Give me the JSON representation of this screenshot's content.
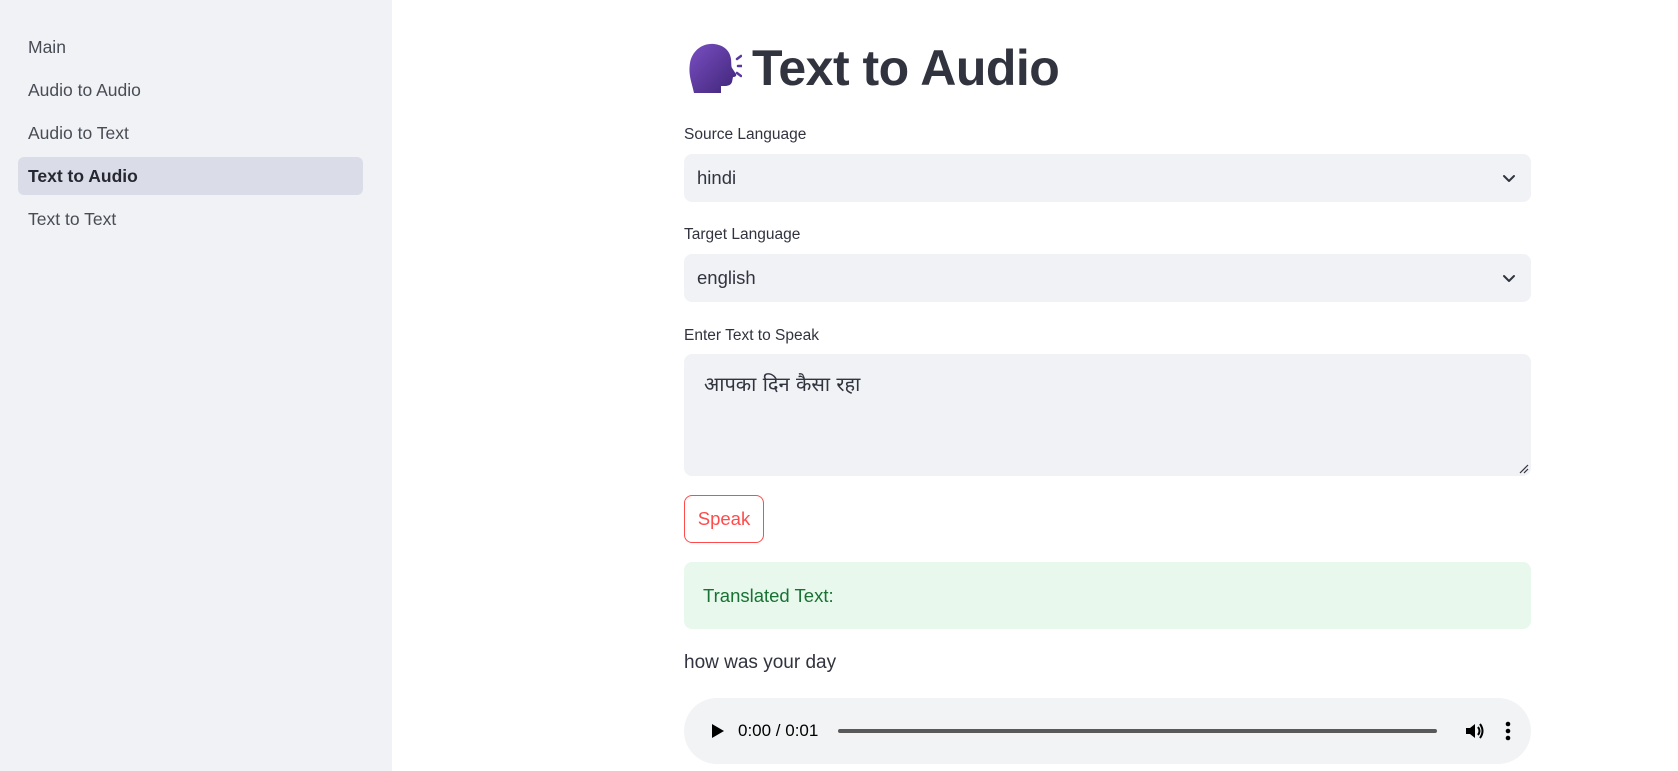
{
  "sidebar": {
    "items": [
      {
        "label": "Main",
        "active": false
      },
      {
        "label": "Audio to Audio",
        "active": false
      },
      {
        "label": "Audio to Text",
        "active": false
      },
      {
        "label": "Text to Audio",
        "active": true
      },
      {
        "label": "Text to Text",
        "active": false
      }
    ]
  },
  "page": {
    "title": "Text to Audio",
    "title_icon": "speaking-head-icon"
  },
  "form": {
    "source_language_label": "Source Language",
    "source_language_value": "hindi",
    "target_language_label": "Target Language",
    "target_language_value": "english",
    "text_label": "Enter Text to Speak",
    "text_value": "आपका दिन कैसा रहा",
    "speak_label": "Speak"
  },
  "result": {
    "success_label": "Translated Text:",
    "translated_text": "how was your day"
  },
  "audio": {
    "time": "0:00 / 0:01",
    "progress": 0
  },
  "colors": {
    "sidebar_bg": "#f0f2f6",
    "accent": "#ff4b4b",
    "success_bg": "#e8f8ec",
    "success_text": "#177233"
  }
}
